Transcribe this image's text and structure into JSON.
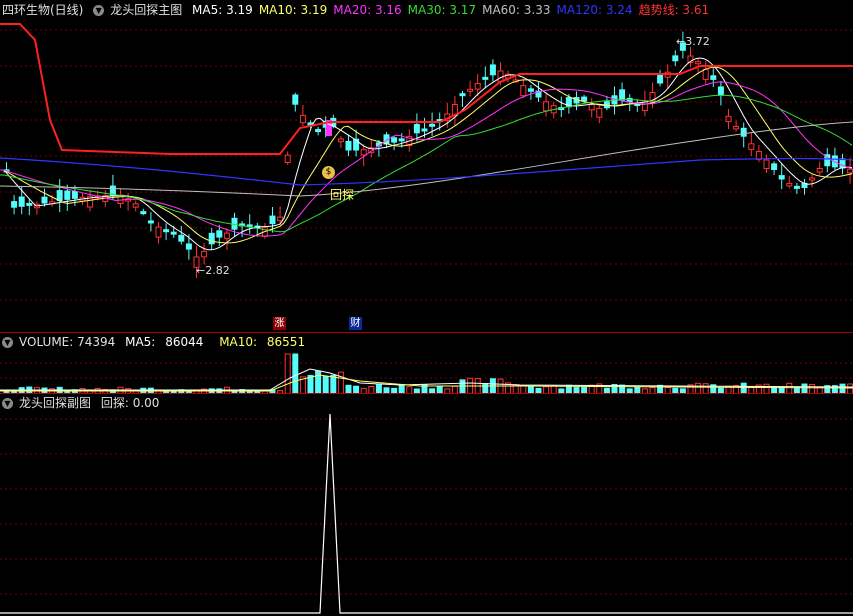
{
  "main": {
    "stock_name": "四环生物(日线)",
    "indicator_name": "龙头回探主图",
    "ma": [
      {
        "label": "MA5:",
        "value": "3.19",
        "color": "#ffffff"
      },
      {
        "label": "MA10:",
        "value": "3.19",
        "color": "#ffff66"
      },
      {
        "label": "MA20:",
        "value": "3.16",
        "color": "#ff33ff"
      },
      {
        "label": "MA30:",
        "value": "3.17",
        "color": "#33dd33"
      },
      {
        "label": "MA60:",
        "value": "3.33",
        "color": "#c0c0c0"
      },
      {
        "label": "MA120:",
        "value": "3.24",
        "color": "#3333ff"
      },
      {
        "label": "趋势线:",
        "value": "3.61",
        "color": "#ff3333"
      }
    ],
    "high_label": "3.72",
    "low_label": "2.82",
    "signal_label": "回探",
    "badge_zhang": "涨",
    "badge_cai": "财",
    "colors": {
      "up": "#ff3232",
      "down": "#54fcfc",
      "grid": "#8b0000",
      "trend": "#ff2020"
    }
  },
  "volume": {
    "label": "VOLUME: 74394",
    "ma5_label": "MA5:",
    "ma5_value": "86044",
    "ma10_label": "MA10:",
    "ma10_value": "86551"
  },
  "sub": {
    "title": "龙头回探副图",
    "value_label": "回探: 0.00"
  }
}
